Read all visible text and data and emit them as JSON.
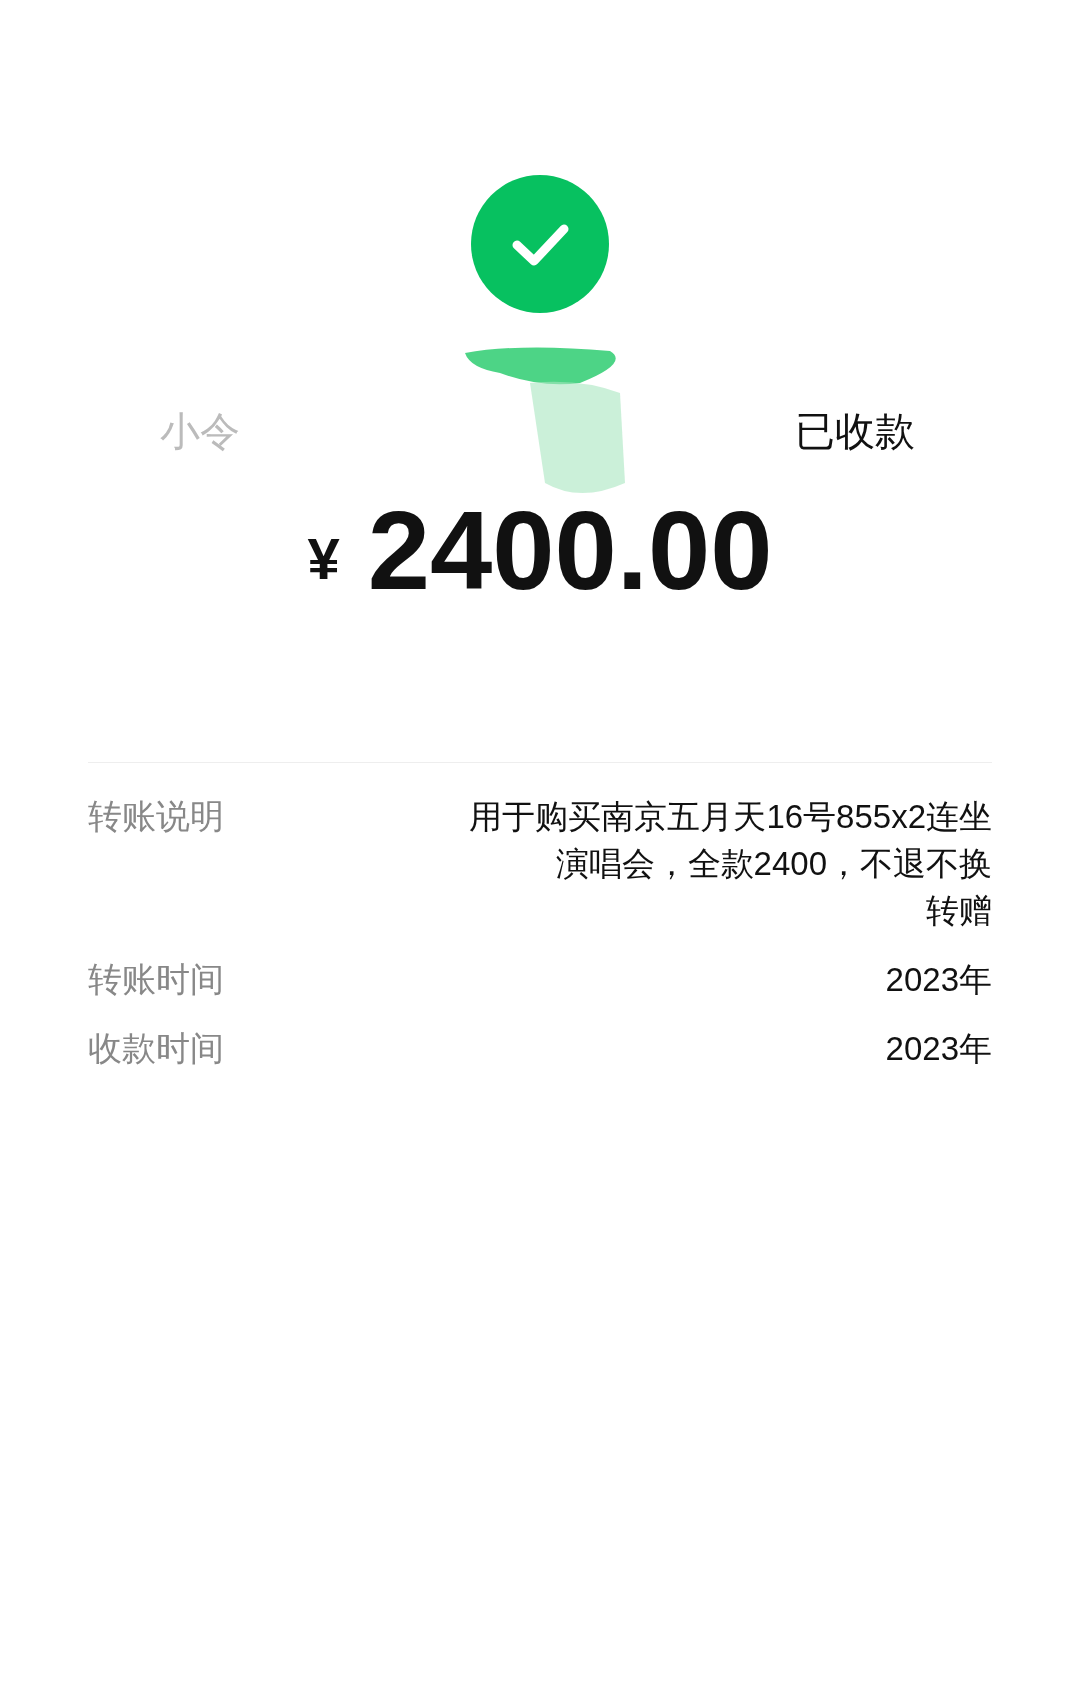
{
  "status": {
    "recipient_visible": "小令",
    "text": "已收款"
  },
  "amount": {
    "currency": "¥",
    "value": "2400.00"
  },
  "details": [
    {
      "label": "转账说明",
      "lines": [
        "用于购买南京五月天16号855x2连坐",
        "演唱会，全款2400，不退不换",
        "转赠"
      ]
    },
    {
      "label": "转账时间",
      "lines": [
        "2023年"
      ]
    },
    {
      "label": "收款时间",
      "lines": [
        "2023年"
      ]
    }
  ]
}
